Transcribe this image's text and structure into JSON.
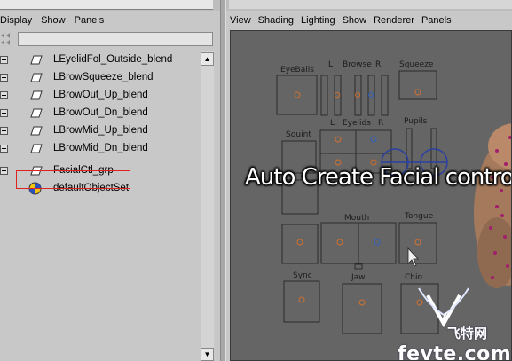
{
  "outliner": {
    "menu": [
      "Display",
      "Show",
      "Panels"
    ],
    "search_value": "",
    "items": [
      {
        "label": "LEyelidFol_Outside_blend",
        "expandable": true,
        "icon": "blendshape-node-icon"
      },
      {
        "label": "LBrowSqueeze_blend",
        "expandable": true,
        "icon": "blendshape-node-icon"
      },
      {
        "label": "LBrowOut_Up_blend",
        "expandable": true,
        "icon": "blendshape-node-icon"
      },
      {
        "label": "LBrowOut_Dn_blend",
        "expandable": true,
        "icon": "blendshape-node-icon"
      },
      {
        "label": "LBrowMid_Up_blend",
        "expandable": true,
        "icon": "blendshape-node-icon"
      },
      {
        "label": "LBrowMid_Dn_blend",
        "expandable": true,
        "icon": "blendshape-node-icon"
      },
      {
        "label": "FacialCtl_grp",
        "expandable": true,
        "icon": "group-node-icon",
        "highlighted": true
      },
      {
        "label": "defaultObjectSet",
        "expandable": false,
        "icon": "object-set-icon"
      }
    ],
    "highlight_color": "#dd2222"
  },
  "viewport": {
    "menu": [
      "View",
      "Shading",
      "Lighting",
      "Show",
      "Renderer",
      "Panels"
    ],
    "overlay_title": "Auto Create Facial control",
    "control_labels": {
      "eyeballs": "EyeBalls",
      "browse": "Browse",
      "squeeze": "Squeeze",
      "eyelids": "Eyelids",
      "pupils": "Pupils",
      "squint": "Squint",
      "mouth": "Mouth",
      "tongue": "Tongue",
      "sync": "Sync",
      "jaw": "Jaw",
      "chin": "Chin",
      "l_mark": "L",
      "r_mark": "R"
    },
    "background_color": "#656565"
  },
  "watermark": {
    "cn": "飞特网",
    "en": "fevte.com",
    "logo_letter": "V"
  }
}
